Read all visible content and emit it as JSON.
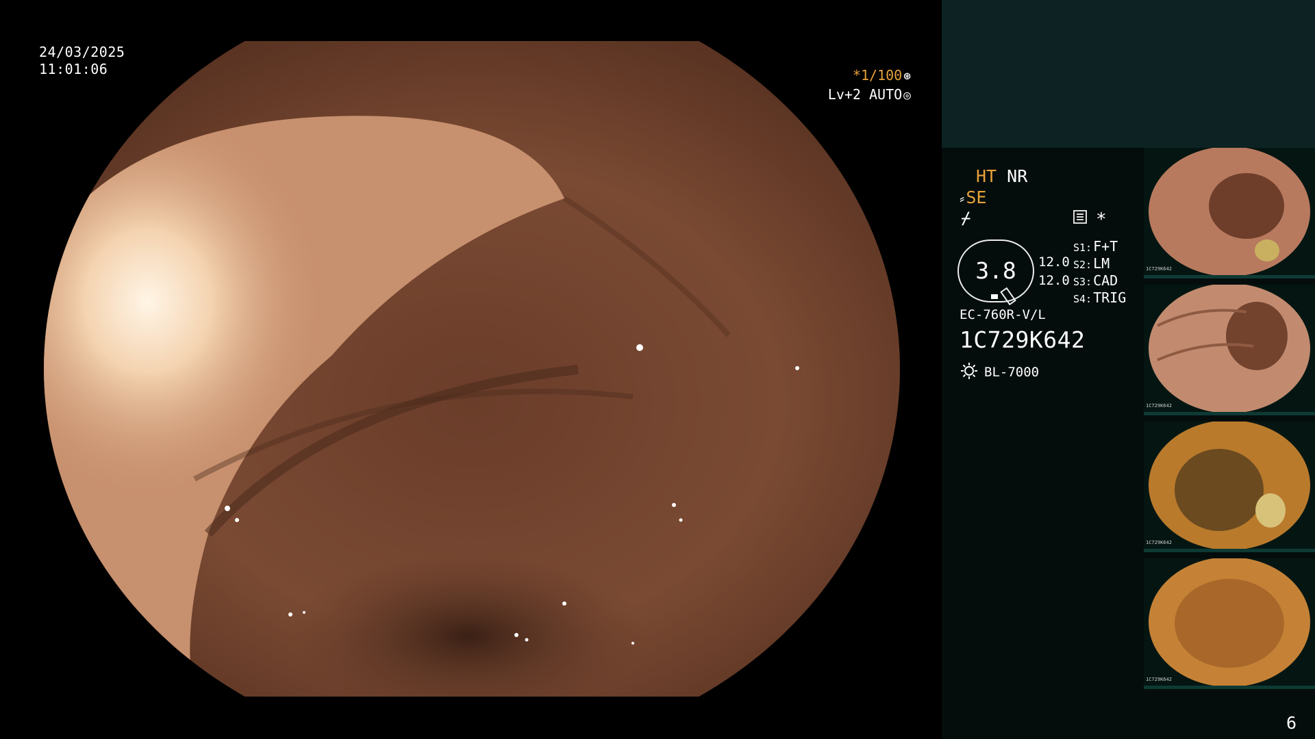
{
  "overlay": {
    "date": "24/03/2025",
    "time": "11:01:06",
    "shutter": "*1/100",
    "iris": "Lv+2 AUTO"
  },
  "panel": {
    "ht_label": "HT",
    "nr_label": "NR",
    "se_label": "SE",
    "gauge_value": "3.8",
    "value_1": "12.0",
    "value_2": "12.0",
    "switches": [
      {
        "key": "S1:",
        "value": "F+T"
      },
      {
        "key": "S2:",
        "value": "LM"
      },
      {
        "key": "S3:",
        "value": "CAD"
      },
      {
        "key": "S4:",
        "value": "TRIG"
      }
    ],
    "scope_model": "EC-760R-V/L",
    "scope_serial": "1C729K642",
    "light_source": "BL-7000",
    "star": "*"
  },
  "thumbnails": [
    {
      "serial": "1C729K642"
    },
    {
      "serial": "1C729K642"
    },
    {
      "serial": "1C729K642"
    },
    {
      "serial": "1C729K642"
    }
  ],
  "page_number": "6",
  "colors": {
    "accent_orange": "#e8a23a",
    "panel_bg": "#040d0c",
    "panel_top_bg": "#0c2223",
    "tissue": "#7a4a33"
  },
  "icons": [
    "shutter-icon",
    "iris-icon",
    "hood-icon",
    "structure-icon",
    "menu-icon",
    "light-source-icon"
  ]
}
